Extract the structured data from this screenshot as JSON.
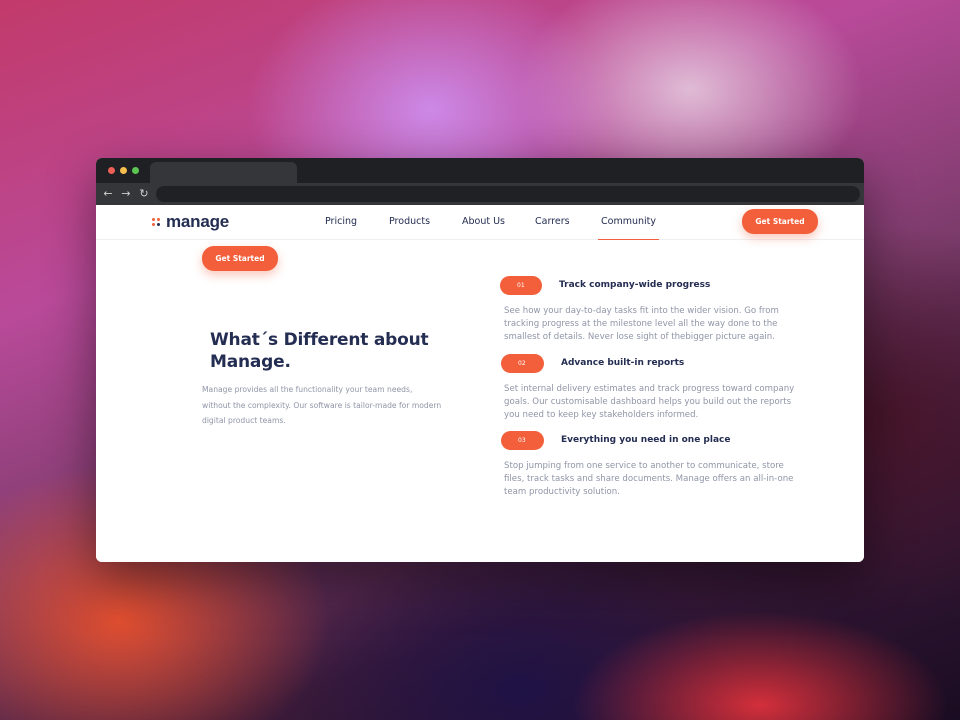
{
  "browser": {
    "url": ""
  },
  "brand": {
    "name": "manage"
  },
  "nav": {
    "items": [
      {
        "label": "Pricing"
      },
      {
        "label": "Products"
      },
      {
        "label": "About Us"
      },
      {
        "label": "Carrers"
      },
      {
        "label": "Community",
        "active": true
      }
    ],
    "cta_label": "Get Started"
  },
  "hero": {
    "cta_label": "Get Started",
    "headline": "What´s Different about Manage.",
    "intro": "Manage provides all the functionality your team needs, without the complexity. Our software is tailor-made for modern digital product teams."
  },
  "features": [
    {
      "number": "01",
      "title": "Track company-wide progress",
      "description": "See how your day-to-day tasks fit into the wider vision. Go from tracking progress at the milestone level all the way done to the smallest of details. Never lose sight of thebigger picture again."
    },
    {
      "number": "02",
      "title": "Advance built-in reports",
      "description": "Set internal delivery estimates and track progress toward company goals. Our customisable dashboard helps you build out the reports you need to keep key stakeholders informed."
    },
    {
      "number": "03",
      "title": "Everything you need in one place",
      "description": "Stop jumping from one service to another to communicate, store files, track tasks and share documents. Manage offers an all-in-one team productivity solution."
    }
  ],
  "colors": {
    "accent": "#f25f3a",
    "heading": "#242d52",
    "body_text": "#9095a7"
  }
}
